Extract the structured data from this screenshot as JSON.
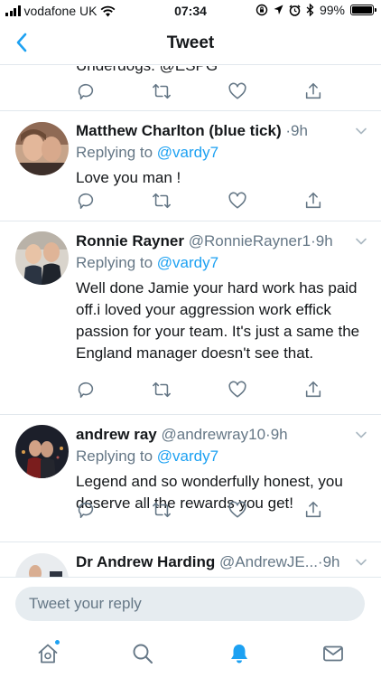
{
  "status_bar": {
    "carrier": "vodafone UK",
    "time": "07:34",
    "battery": "99%",
    "battery_level": 0.99
  },
  "header": {
    "title": "Tweet",
    "back_icon": "chevron-left-icon"
  },
  "partial_tweet": {
    "text": "Underdogs. @ESPG"
  },
  "tweets": [
    {
      "name": "Matthew Charlton (blue tick)",
      "handle": "",
      "dot": "·",
      "time": "9h",
      "replying_prefix": "Replying to",
      "replying_to": "@vardy7",
      "body": "Love you man !"
    },
    {
      "name": "Ronnie Rayner",
      "handle": "@RonnieRayner1",
      "dot": "·",
      "time": "9h",
      "replying_prefix": "Replying to",
      "replying_to": "@vardy7",
      "body": "Well done Jamie your hard work has paid off.i loved your aggression work effick passion for your team. It's just a same the England manager doesn't see that."
    },
    {
      "name": "andrew ray",
      "handle": "@andrewray10",
      "dot": "·",
      "time": "9h",
      "replying_prefix": "Replying to",
      "replying_to": "@vardy7",
      "body": "Legend and so wonderfully honest, you deserve all the rewards you get!"
    },
    {
      "name": "Dr Andrew Harding",
      "handle": "@AndrewJE...",
      "dot": "·",
      "time": "9h"
    }
  ],
  "reply_bar": {
    "placeholder": "Tweet your reply"
  },
  "tab_bar": {
    "items": [
      "home-icon",
      "search-icon",
      "notifications-icon",
      "messages-icon"
    ],
    "active": "notifications-icon"
  },
  "colors": {
    "accent": "#1da1f2",
    "secondary_text": "#657786",
    "divider": "#e1e8ed",
    "reply_field": "#e6ecf0"
  }
}
